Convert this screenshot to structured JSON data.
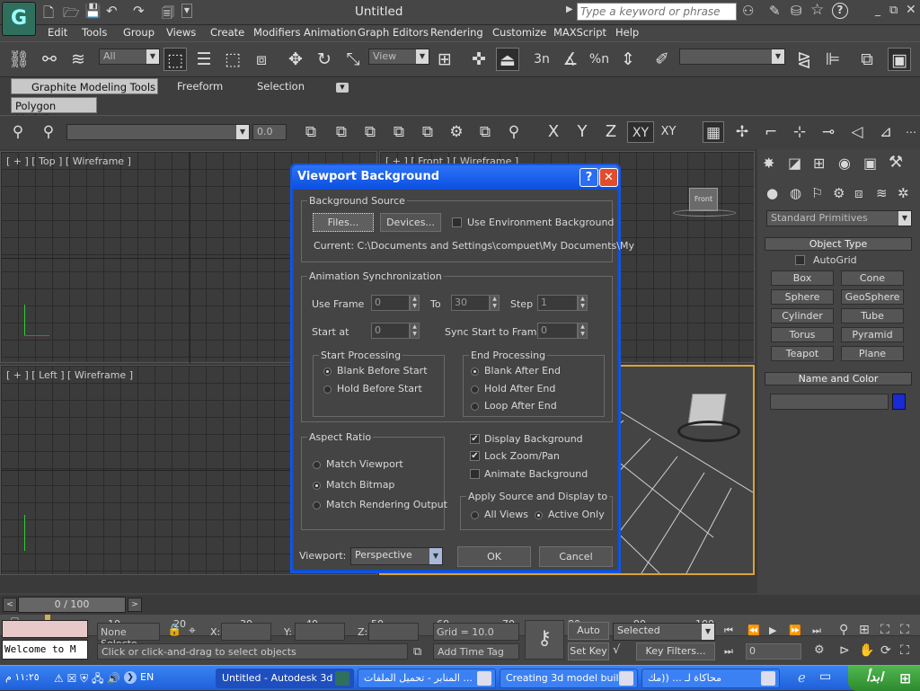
{
  "titlebar": {
    "title": "Untitled",
    "search_placeholder": "Type a keyword or phrase",
    "app_logo_letter": "G"
  },
  "menu": [
    "Edit",
    "Tools",
    "Group",
    "Views",
    "Create",
    "Modifiers",
    "Animation",
    "Graph Editors",
    "Rendering",
    "Customize",
    "MAXScript",
    "Help"
  ],
  "toolbar": {
    "selection_filter": "All",
    "ref_coord": "View",
    "snap_label": "3n",
    "angle_snap_label": "%n"
  },
  "ribbon": {
    "tabs": [
      "Graphite Modeling Tools",
      "Freeform",
      "Selection"
    ],
    "panel_tab": "Polygon Modeling",
    "spinner_value": "0.0",
    "axis_labels": [
      "X",
      "Y",
      "Z",
      "XY",
      "XY"
    ]
  },
  "viewports": {
    "top": "[ + ] [ Top ] [ Wireframe ]",
    "front": "[ + ] [ Front ] [ Wireframe ]",
    "left": "[ + ] [ Left ] [ Wireframe ]",
    "viewcube_front": "Front"
  },
  "command_panel": {
    "category": "Standard Primitives",
    "object_type_header": "Object Type",
    "autogrid": "AutoGrid",
    "buttons": [
      "Box",
      "Cone",
      "Sphere",
      "GeoSphere",
      "Cylinder",
      "Tube",
      "Torus",
      "Pyramid",
      "Teapot",
      "Plane"
    ],
    "name_color_header": "Name and Color",
    "object_color": "#1a2ad6"
  },
  "dialog": {
    "title": "Viewport Background",
    "help_glyph": "?",
    "close_glyph": "✕",
    "background_source": {
      "title": "Background Source",
      "files": "Files...",
      "devices": "Devices...",
      "use_env": "Use Environment Background",
      "current": "Current: C:\\Documents and Settings\\compuet\\My Documents\\My"
    },
    "anim_sync": {
      "title": "Animation Synchronization",
      "use_frame": "Use Frame",
      "use_frame_val": "0",
      "to": "To",
      "to_val": "30",
      "step": "Step",
      "step_val": "1",
      "start_at": "Start at",
      "start_at_val": "0",
      "sync_start": "Sync Start to Frame",
      "sync_start_val": "0",
      "start_proc": "Start Processing",
      "blank_before": "Blank Before Start",
      "hold_before": "Hold Before Start",
      "end_proc": "End Processing",
      "blank_after": "Blank After End",
      "hold_after": "Hold After End",
      "loop_after": "Loop After End"
    },
    "aspect": {
      "title": "Aspect Ratio",
      "match_viewport": "Match Viewport",
      "match_bitmap": "Match Bitmap",
      "match_render": "Match Rendering Output"
    },
    "display_bg": "Display Background",
    "lock_zoom": "Lock Zoom/Pan",
    "animate_bg": "Animate Background",
    "apply": {
      "title": "Apply Source and Display to",
      "all_views": "All Views",
      "active_only": "Active Only"
    },
    "viewport_label": "Viewport:",
    "viewport_value": "Perspective",
    "ok": "OK",
    "cancel": "Cancel"
  },
  "timeline": {
    "slider_label": "0 / 100",
    "ticks": [
      "10",
      "20",
      "30",
      "40",
      "50",
      "60",
      "70",
      "80",
      "90",
      "100"
    ]
  },
  "status": {
    "selection": "None Selecte",
    "x_label": "X:",
    "y_label": "Y:",
    "z_label": "Z:",
    "grid": "Grid = 10.0",
    "auto_key": "Auto Key",
    "selected": "Selected",
    "set_key": "Set Key",
    "key_filters": "Key Filters...",
    "frame_value": "0",
    "prompt": "Click or click-and-drag to select objects",
    "add_time_tag": "Add Time Tag",
    "listener": "Welcome to M"
  },
  "taskbar": {
    "start_label": "ابدأ",
    "tasks": [
      "Untitled - Autodesk 3d",
      "المنابر - تحميل الملفات ...",
      "Creating 3d model buil",
      "محاكاة لـ ... ((مك",
      "EN"
    ],
    "clock": "١١:٢٥ م"
  }
}
